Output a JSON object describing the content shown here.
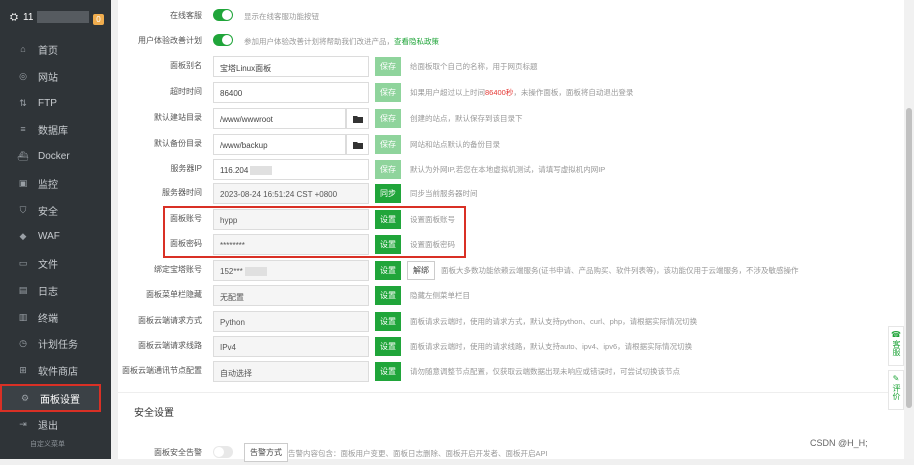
{
  "sidebar": {
    "server_name": "11",
    "badge": "0",
    "items": [
      {
        "label": "首页",
        "icon": "home-icon",
        "glyph": "⌂"
      },
      {
        "label": "网站",
        "icon": "globe-icon",
        "glyph": "◎"
      },
      {
        "label": "FTP",
        "icon": "ftp-icon",
        "glyph": "⇅"
      },
      {
        "label": "数据库",
        "icon": "database-icon",
        "glyph": "≡"
      },
      {
        "label": "Docker",
        "icon": "docker-icon",
        "glyph": "⛴"
      },
      {
        "label": "监控",
        "icon": "monitor-icon",
        "glyph": "▣"
      },
      {
        "label": "安全",
        "icon": "shield-icon",
        "glyph": "⛉"
      },
      {
        "label": "WAF",
        "icon": "waf-icon",
        "glyph": "◆"
      },
      {
        "label": "文件",
        "icon": "folder-icon",
        "glyph": "▭"
      },
      {
        "label": "日志",
        "icon": "log-icon",
        "glyph": "▤"
      },
      {
        "label": "终端",
        "icon": "terminal-icon",
        "glyph": "▥"
      },
      {
        "label": "计划任务",
        "icon": "clock-icon",
        "glyph": "◷"
      },
      {
        "label": "软件商店",
        "icon": "store-icon",
        "glyph": "⊞"
      },
      {
        "label": "面板设置",
        "icon": "gear-icon",
        "glyph": "⚙"
      },
      {
        "label": "退出",
        "icon": "logout-icon",
        "glyph": "⇥"
      }
    ],
    "sub_item": "自定义菜单"
  },
  "settings": {
    "online_service": {
      "label": "在线客服",
      "desc": "显示在线客服功能按钮"
    },
    "ux_plan": {
      "label": "用户体验改善计划",
      "desc": "参加用户体验改善计划将帮助我们改进产品，",
      "link": "查看隐私政策"
    },
    "panel_alias": {
      "label": "面板别名",
      "value": "宝塔Linux面板",
      "btn": "保存",
      "desc": "给面板取个自己的名称，用于网页标题"
    },
    "timeout": {
      "label": "超时时间",
      "value": "86400",
      "btn": "保存",
      "desc_pre": "如果用户超过以上时间",
      "desc_red": "86400秒",
      "desc_post": "，未操作面板，面板将自动退出登录"
    },
    "site_dir": {
      "label": "默认建站目录",
      "value": "/www/wwwroot",
      "btn": "保存",
      "desc": "创建的站点，默认保存到该目录下"
    },
    "backup_dir": {
      "label": "默认备份目录",
      "value": "/www/backup",
      "btn": "保存",
      "desc": "网站和站点默认的备份目录"
    },
    "server_ip": {
      "label": "服务器IP",
      "value": "116.204",
      "btn": "保存",
      "desc": "默认为外网IP,若您在本地虚拟机测试，请填写虚拟机内网IP"
    },
    "server_time": {
      "label": "服务器时间",
      "value": "2023-08-24 16:51:24 CST +0800",
      "btn": "同步",
      "desc": "同步当前服务器时间"
    },
    "panel_user": {
      "label": "面板账号",
      "value": "hypp",
      "btn": "设置",
      "desc": "设置面板账号"
    },
    "panel_pass": {
      "label": "面板密码",
      "value": "********",
      "btn": "设置",
      "desc": "设置面板密码"
    },
    "bt_account": {
      "label": "绑定宝塔账号",
      "value": "152***",
      "btn": "设置",
      "btn2": "解绑",
      "desc": "面板大多数功能依赖云端服务(证书申请、产品购买、软件列表等)，该功能仅用于云端服务，不涉及敏感操作"
    },
    "menu_hide": {
      "label": "面板菜单栏隐藏",
      "value": "无配置",
      "btn": "设置",
      "desc": "隐藏左侧菜单栏目"
    },
    "cloud_method": {
      "label": "面板云端请求方式",
      "value": "Python",
      "btn": "设置",
      "desc": "面板请求云端时，使用的请求方式，默认支持python、curl、php，请根据实际情况切换"
    },
    "cloud_line": {
      "label": "面板云端请求线路",
      "value": "IPv4",
      "btn": "设置",
      "desc": "面板请求云端时，使用的请求线路，默认支持auto、ipv4、ipv6，请根据实际情况切换"
    },
    "cloud_node": {
      "label": "面板云端通讯节点配置",
      "value": "自动选择",
      "btn": "设置",
      "desc": "请勿随意调整节点配置，仅获取云端数据出现未响应或错误时，可尝试切换该节点"
    }
  },
  "security": {
    "title": "安全设置",
    "alert_label": "面板安全告警",
    "alert_btn": "告警方式",
    "alert_desc": "告警内容包含：面板用户变更、面板日志删除、面板开启开发者、面板开启API"
  },
  "float": {
    "service": "客服",
    "feedback": "评价"
  },
  "watermark": "CSDN @H_H;"
}
